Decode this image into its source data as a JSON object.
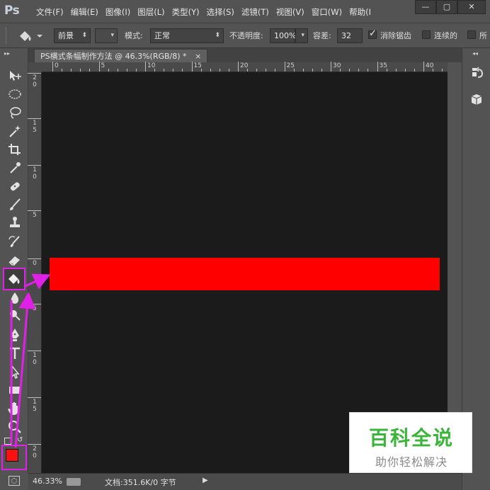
{
  "app": {
    "logo": "Ps"
  },
  "menu": {
    "items": [
      "文件(F)",
      "编辑(E)",
      "图像(I)",
      "图层(L)",
      "类型(Y)",
      "选择(S)",
      "滤镜(T)",
      "视图(V)",
      "窗口(W)",
      "帮助(I"
    ]
  },
  "window_controls": {
    "minimize": "—",
    "maximize": "▢",
    "close": "✕"
  },
  "options": {
    "fill_source": "前景",
    "mode_label": "模式:",
    "mode_value": "正常",
    "opacity_label": "不透明度:",
    "opacity_value": "100%",
    "tolerance_label": "容差:",
    "tolerance_value": "32",
    "antialias_label": "消除锯齿",
    "antialias_checked": true,
    "contiguous_label": "连续的",
    "contiguous_checked": false,
    "all_layers_label": "所"
  },
  "document": {
    "tab_title": "PS横式条幅制作方法 @ 46.3%(RGB/8) *",
    "tab_close": "×",
    "fill_color": "#ff0000",
    "canvas_color": "#1b1b1b"
  },
  "rulers": {
    "horizontal": [
      "0",
      "5",
      "10",
      "15",
      "20",
      "25",
      "30",
      "35",
      "40"
    ],
    "vertical": [
      {
        "digits": [
          "2",
          "0"
        ]
      },
      {
        "digits": [
          "1",
          "5"
        ]
      },
      {
        "digits": [
          "1",
          "0"
        ]
      },
      {
        "digits": [
          "5"
        ]
      },
      {
        "digits": [
          "0"
        ]
      },
      {
        "digits": [
          "5"
        ]
      },
      {
        "digits": [
          "1",
          "0"
        ]
      },
      {
        "digits": [
          "1",
          "5"
        ]
      },
      {
        "digits": [
          "2",
          "0"
        ]
      }
    ]
  },
  "tools": [
    "move-tool",
    "marquee-tool",
    "lasso-tool",
    "magic-wand-tool",
    "crop-tool",
    "eyedropper-tool",
    "healing-brush-tool",
    "brush-tool",
    "stamp-tool",
    "history-brush-tool",
    "eraser-tool",
    "paint-bucket-tool",
    "blur-tool",
    "dodge-tool",
    "pen-tool",
    "type-tool",
    "path-selection-tool",
    "rectangle-tool",
    "hand-tool",
    "zoom-tool"
  ],
  "active_tool": "paint-bucket-tool",
  "colors": {
    "foreground": "#ff1010",
    "background": "#ffffff",
    "highlight": "#e020e6"
  },
  "status": {
    "zoom": "46.33%",
    "doc_info": "文档:351.6K/0 字节"
  },
  "watermark": {
    "title": "百科全说",
    "subtitle": "助你轻松解决"
  }
}
